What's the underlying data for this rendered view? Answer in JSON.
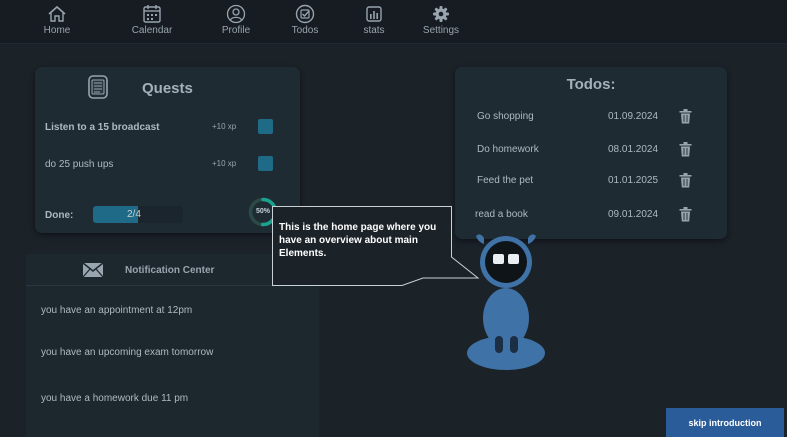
{
  "nav": {
    "items": [
      {
        "label": "Home",
        "icon": "home-icon"
      },
      {
        "label": "Calendar",
        "icon": "calendar-icon"
      },
      {
        "label": "Profile",
        "icon": "profile-icon"
      },
      {
        "label": "Todos",
        "icon": "todos-icon"
      },
      {
        "label": "stats",
        "icon": "stats-icon"
      },
      {
        "label": "Settings",
        "icon": "gear-icon"
      }
    ]
  },
  "quests": {
    "title": "Quests",
    "items": [
      {
        "name": "Listen to a 15 broadcast",
        "xp": "+10 xp",
        "checked": false
      },
      {
        "name": "do 25 push ups",
        "xp": "+10 xp",
        "checked": false
      }
    ],
    "done_label": "Done:",
    "progress_text": "2/4",
    "progress_fraction": 0.5,
    "percent_text": "50%"
  },
  "notifications": {
    "title": "Notification Center",
    "items": [
      "you have an appointment at 12pm",
      "you have an upcoming exam tomorrow",
      "you have a homework due 11 pm"
    ]
  },
  "todos": {
    "title": "Todos:",
    "items": [
      {
        "name": "Go shopping",
        "date": "01.09.2024"
      },
      {
        "name": "Do homework",
        "date": "08.01.2024"
      },
      {
        "name": "Feed the pet",
        "date": "01.01.2025"
      },
      {
        "name": "read a book",
        "date": "09.01.2024"
      }
    ]
  },
  "tooltip": {
    "text": "This is the home page where you have an overview about main Elements."
  },
  "skip_button": "skip introduction",
  "colors": {
    "background": "#1b2228",
    "card": "#1f2b33",
    "accent": "#1f6a86",
    "ring": "#1aa38f",
    "robot": "#3f72a6",
    "button": "#2a5c9a"
  }
}
